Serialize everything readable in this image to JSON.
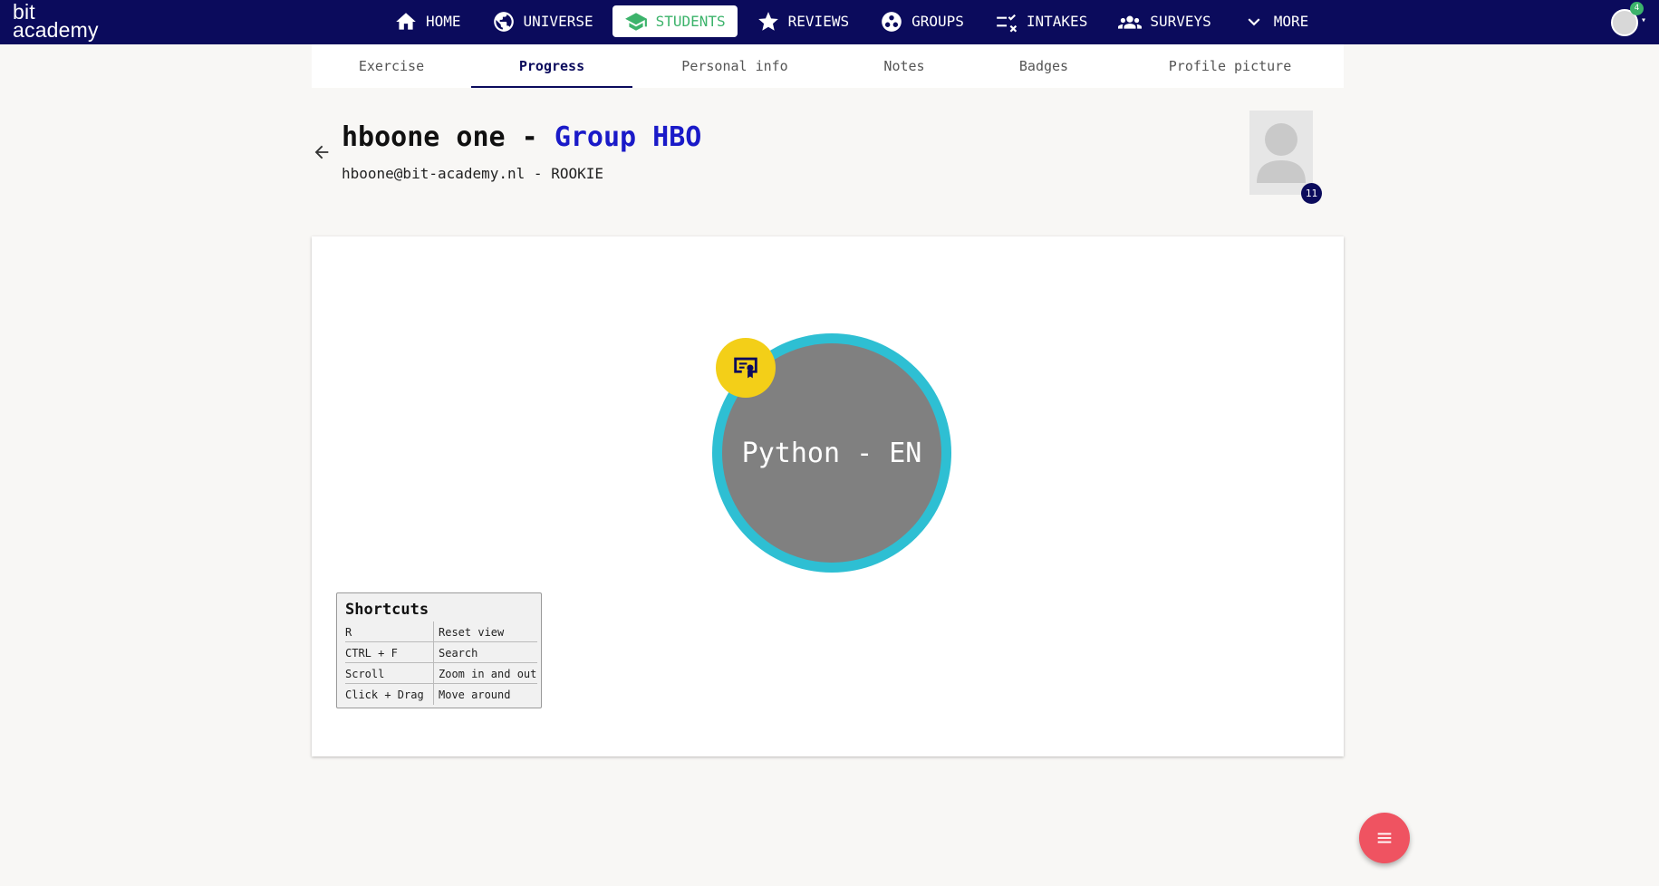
{
  "logo": {
    "line1": "bit",
    "line2": "academy"
  },
  "nav": [
    {
      "label": "HOME",
      "icon": "home-icon"
    },
    {
      "label": "UNIVERSE",
      "icon": "globe-icon"
    },
    {
      "label": "STUDENTS",
      "icon": "graduation-cap-icon",
      "active": true
    },
    {
      "label": "REVIEWS",
      "icon": "star-icon"
    },
    {
      "label": "GROUPS",
      "icon": "groups-icon"
    },
    {
      "label": "INTAKES",
      "icon": "checklist-icon"
    },
    {
      "label": "SURVEYS",
      "icon": "people-icon"
    },
    {
      "label": "MORE",
      "icon": "chevron-down-icon"
    }
  ],
  "user": {
    "notification_count": "4"
  },
  "tabs": [
    "Exercise",
    "Progress",
    "Personal info",
    "Notes",
    "Badges",
    "Profile picture"
  ],
  "active_tab": "Progress",
  "student": {
    "name": "hboone one - ",
    "group": "Group HBO",
    "info": "hboone@bit-academy.nl - ROOKIE",
    "badge_count": "11"
  },
  "course": {
    "label": "Python - EN"
  },
  "shortcuts": {
    "title": "Shortcuts",
    "rows": [
      {
        "key": "R",
        "action": "Reset view"
      },
      {
        "key": "CTRL + F",
        "action": "Search"
      },
      {
        "key": "Scroll",
        "action": "Zoom in and out"
      },
      {
        "key": "Click + Drag",
        "action": "Move around"
      }
    ]
  },
  "colors": {
    "nav_bg": "#0b0b5c",
    "active": "#3cb36b",
    "ring": "#2ebfd3",
    "certificate": "#f3cf18",
    "fab": "#ef5361"
  }
}
